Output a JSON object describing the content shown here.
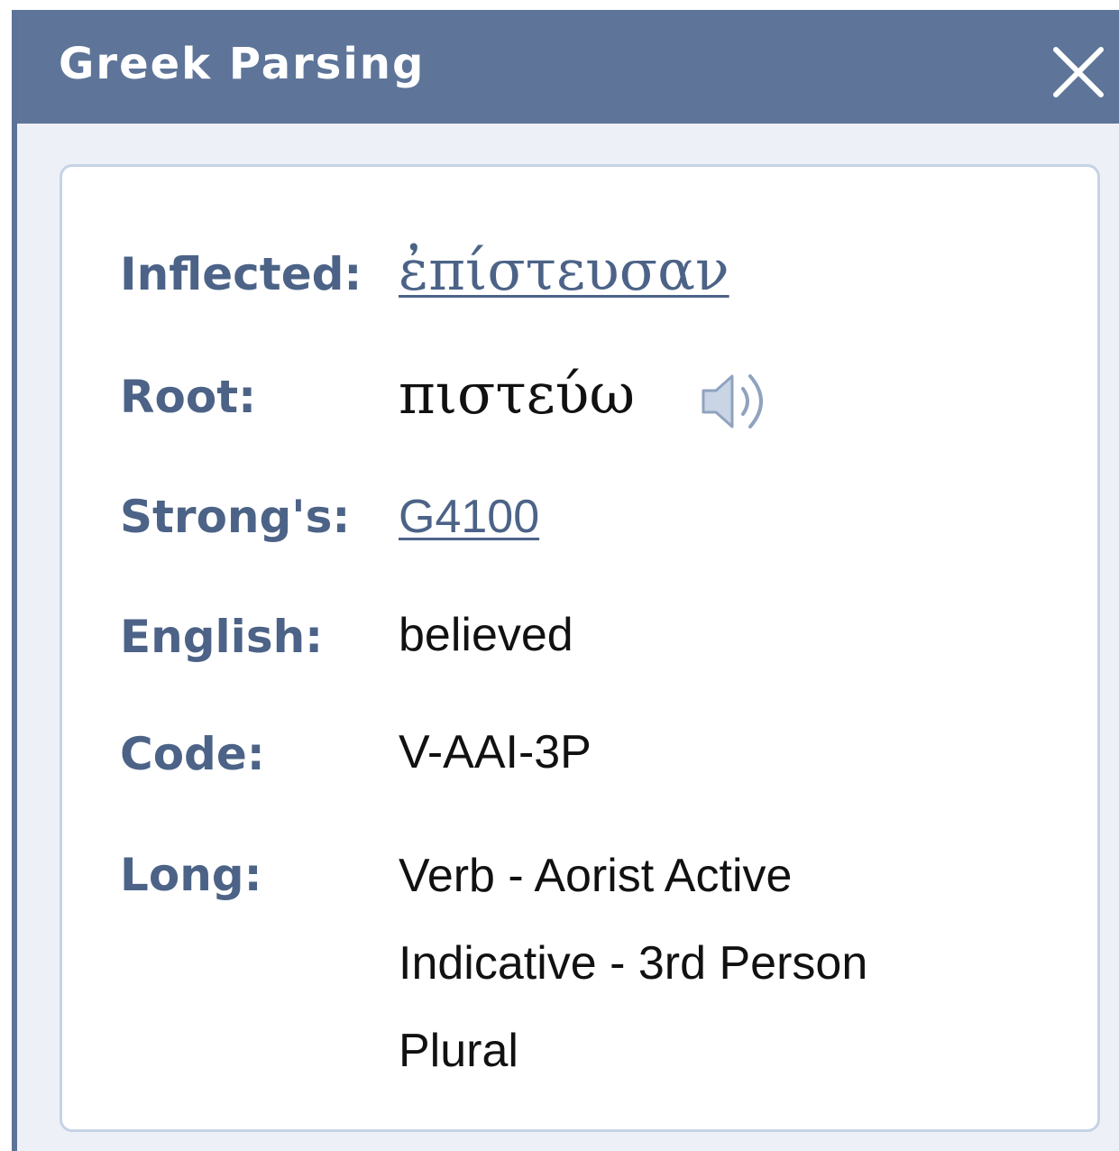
{
  "dialog": {
    "title": "Greek Parsing",
    "close_icon": "close-icon"
  },
  "parsing": {
    "inflected_label": "Inflected:",
    "inflected_value": "ἐπίστευσαν",
    "root_label": "Root:",
    "root_value": "πιστεύω",
    "audio_icon": "speaker-icon",
    "strongs_label": "Strong's:",
    "strongs_value": "G4100",
    "english_label": "English:",
    "english_value": "believed",
    "code_label": "Code:",
    "code_value": "V-AAI-3P",
    "long_label": "Long:",
    "long_value": "Verb - Aorist Active Indicative - 3rd Person Plural"
  },
  "colors": {
    "titlebar": "#5e7599",
    "label": "#4c6387",
    "card_border": "#c6d3e4",
    "dialog_bg": "#eef0f8"
  }
}
